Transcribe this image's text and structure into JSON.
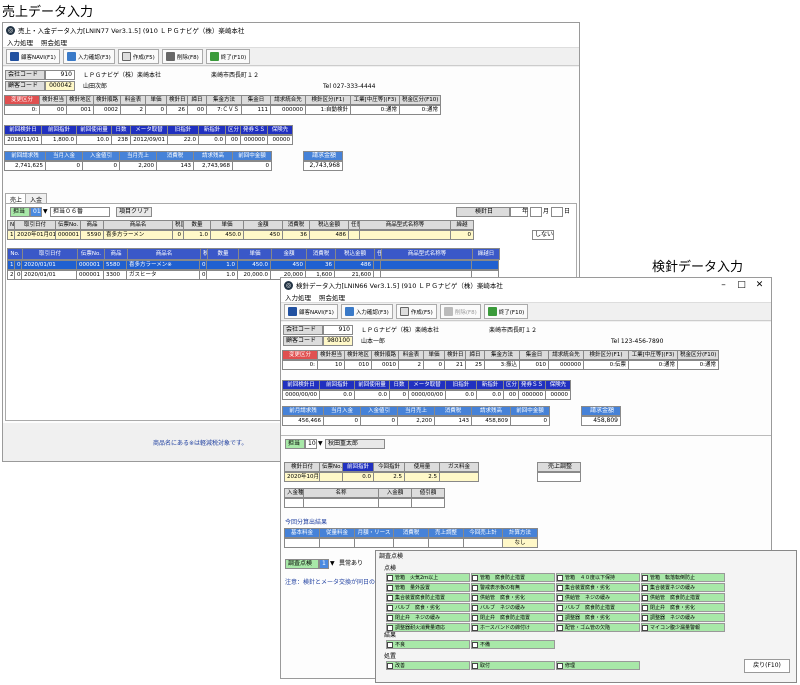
{
  "title1": "売上データ入力",
  "title2": "検針データ入力",
  "win1": {
    "titlebar": "売上・入金データ入力[LNIN77 Ver3.1.5] (910 ＬＰＧナビゲ（株）楽崎本社",
    "menu": [
      "入力処理",
      "照会処理"
    ],
    "toolbar": [
      "顧客NAVI(F1)",
      "入力確認(F3)",
      "作成(F5)",
      "削除(F8)",
      "終了(F10)"
    ],
    "kaisha_label": "会社コード",
    "kaisha_code": "910",
    "kaisha_name": "ＬＰＧナビゲ（株）楽崎本社",
    "kaisha_addr": "楽崎市西長町１２",
    "kokyaku_label": "顧客コード",
    "kokyaku_code": "000042",
    "kokyaku_name": "山田次郎",
    "kokyaku_tel": "Tel 027-333-4444",
    "info_headers": [
      "変更区分",
      "検針担当",
      "検針地区",
      "検針順路",
      "料金表",
      "単価",
      "検針日",
      "締日",
      "集金方法",
      "集金日",
      "請求統合先",
      "検針区分(F1)",
      "工業[中圧等](F3)",
      "税金区分(F10)"
    ],
    "info_values": [
      "0:",
      "00",
      "001",
      "0002",
      "2",
      "0",
      "26",
      "00",
      "7:ＣＶＳ",
      "111",
      "000000",
      "1:自動検針",
      "0:通常",
      "0:通常"
    ],
    "prev_headers": [
      "前回検針日",
      "前回指針",
      "前回使用量",
      "日数",
      "メータ取替",
      "旧指針",
      "新指針",
      "区分",
      "発券ＳＳ",
      "保険先"
    ],
    "prev_values": [
      "2018/11/01",
      "1,800.0",
      "10.0",
      "238",
      "2012/09/01",
      "22.0",
      "0.0",
      "00",
      "000000",
      "00000"
    ],
    "seikyu_headers": [
      "前回請求残",
      "当月入金",
      "入金値引",
      "当月売上",
      "消費税",
      "請求残高",
      "前回中金額"
    ],
    "seikyu_values": [
      "2,741,625",
      "0",
      "0",
      "2,200",
      "143",
      "2,743,968",
      "0"
    ],
    "seikyu_label": "請求金額",
    "seikyu_total": "2,743,968",
    "tabs": [
      "売上",
      "入金"
    ],
    "tanto_label": "担当",
    "tanto_code": "01",
    "tanto_name": "担当０６番",
    "clear_btn": "項目クリア",
    "kensin_label": "検針日",
    "kensin_year": "年",
    "kensin_month": "月",
    "kensin_day": "日",
    "entry_headers": [
      "No.",
      "取引日付",
      "伝票No.",
      "商品",
      "商品名",
      "税区",
      "数量",
      "単価",
      "金額",
      "消費税",
      "税込金額",
      "任意",
      "商品型式名称等",
      "繰越"
    ],
    "entry_values": [
      "1",
      "2020年01月01日",
      "000001",
      "5590",
      "喜多方ラーメン",
      "0",
      "1.0",
      "450.0",
      "450",
      "36",
      "486",
      "",
      "",
      "0"
    ],
    "entry_kurikoshi": "しない",
    "list_headers": [
      "No.",
      "取引日付",
      "伝票No.",
      "商品",
      "商品名",
      "税区",
      "数量",
      "単価",
      "金額",
      "消費税",
      "税込金額",
      "任意",
      "商品型式名称等",
      "繰越日"
    ],
    "list_rows": [
      [
        "1",
        "06",
        "2020/01/01",
        "000001",
        "5580",
        "喜多方ラーメン※",
        "0",
        "1.0",
        "450.0",
        "450",
        "36",
        "486",
        "",
        ""
      ],
      [
        "2",
        "06",
        "2020/01/01",
        "000001",
        "3300",
        "ガスヒータ",
        "0",
        "1.0",
        "20,000.0",
        "20,000",
        "1,600",
        "21,600",
        "",
        ""
      ]
    ],
    "footnote": "商品名にある※は軽減税対象です。"
  },
  "win2": {
    "titlebar": "検針データ入力[LNIN66 Ver3.1.5] (910 ＬＰＧナビゲ（株）楽崎本社",
    "menu": [
      "入力処理",
      "照会処理"
    ],
    "toolbar": [
      "顧客NAVI(F1)",
      "入力確認(F3)",
      "作成(F5)",
      "削除(F8)",
      "終了(F10)"
    ],
    "kaisha_label": "会社コード",
    "kaisha_code": "910",
    "kaisha_name": "ＬＰＧナビゲ（株）楽崎本社",
    "kaisha_addr": "楽崎市西長町１２",
    "kokyaku_label": "顧客コード",
    "kokyaku_code": "980100",
    "kokyaku_name": "山本一郎",
    "kokyaku_tel": "Tel 123-456-7890",
    "info_headers": [
      "変更区分",
      "検針担当",
      "検針地区",
      "検針順路",
      "料金表",
      "単価",
      "検針日",
      "締日",
      "集金方法",
      "集金日",
      "請求統合先",
      "検針区分(F1)",
      "工業[中圧等](F3)",
      "税金区分(F10)"
    ],
    "info_values": [
      "0:",
      "10",
      "010",
      "0010",
      "2",
      "0",
      "21",
      "25",
      "3:振込",
      "010",
      "000000",
      "0:伝票",
      "0:通常",
      "0:通常"
    ],
    "prev_headers": [
      "前回検針日",
      "前回指針",
      "前回使用量",
      "日数",
      "メータ取替",
      "旧指針",
      "新指針",
      "区分",
      "発券ＳＳ",
      "保険先"
    ],
    "prev_values": [
      "0000/00/00",
      "0.0",
      "0.0",
      "0",
      "0000/00/00",
      "0.0",
      "0.0",
      "00",
      "000000",
      "00000"
    ],
    "seikyu_headers": [
      "前月請求残",
      "当月入金",
      "入金値引",
      "当月売上",
      "消費税",
      "請求残高",
      "前回中金額"
    ],
    "seikyu_values": [
      "456,466",
      "0",
      "0",
      "2,200",
      "143",
      "458,809",
      "0"
    ],
    "seikyu_label": "請求金額",
    "seikyu_total": "458,809",
    "tanto_label": "担当",
    "tanto_code": "10",
    "tanto_name": "秋田重太郎",
    "ken_headers": [
      "検針日付",
      "伝票No.",
      "前回指針",
      "今回指針",
      "使用量",
      "ガス料金"
    ],
    "ken_values": [
      "2020年10月10日",
      "",
      "0.0",
      "2.5",
      "2.5",
      ""
    ],
    "uriage_label": "売上調整",
    "nyukin_headers": [
      "入金種別",
      "名称",
      "入金額",
      "値引額"
    ],
    "kotei_title": "今回分算出結果",
    "kotei_headers": [
      "基本料金",
      "従量料金",
      "月額・リース",
      "消費税",
      "売上調整",
      "今回売上計",
      "計算方法"
    ],
    "kotei_values": [
      "",
      "",
      "",
      "",
      "",
      "",
      "なし"
    ],
    "chosa_label": "調査点検",
    "chosa_code": "1",
    "chosa_value": "異常あり",
    "note": "注意：検針とメータ交換が同日の"
  },
  "popup": {
    "title": "調査点検",
    "sec1": "点検",
    "items1": [
      "管箱　火気2ｍ以上",
      "管箱　腐食防止措置",
      "管箱　４０度以下保持",
      "管箱　転落転倒防止",
      "管箱　量外設置",
      "警戒表示板の有無",
      "集合装置腐食・劣化",
      "集合装置ネジの緩み",
      "集合装置腐食防止措置",
      "供給管　腐食・劣化",
      "供給管　ネジの緩み",
      "供給管　腐食防止措置",
      "バルブ　腐食・劣化",
      "バルブ　ネジの緩み",
      "バルブ　腐食防止措置",
      "閉止弁　腐食・劣化",
      "閉止弁　ネジの緩み",
      "閉止弁　腐食防止措置",
      "調整器　腐食・劣化",
      "調整器　ネジの緩み",
      "調整器耐火消費量適応",
      "ホースバンドの締付け",
      "配管・ゴム管の欠陥",
      "マイコン腹少漏量警報"
    ],
    "sec2": "結果",
    "items2": [
      "不良",
      "不備"
    ],
    "sec3": "処置",
    "items3": [
      "改善",
      "取付",
      "修理"
    ],
    "back_btn": "戻り(F10)"
  }
}
